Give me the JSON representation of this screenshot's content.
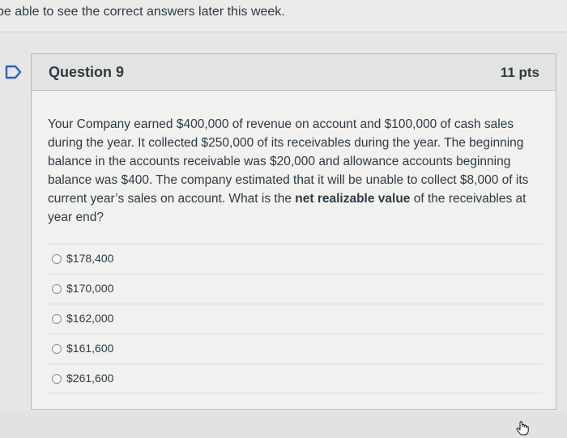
{
  "notice": {
    "text": "be able to see the correct answers later this week."
  },
  "question": {
    "flag_icon": "bookmark-flag-icon",
    "title": "Question 9",
    "points": "11 pts",
    "text_parts": [
      "Your Company earned $400,000 of revenue on account and $100,000 of cash sales during the year.  It collected $250,000 of its receivables during the year.  The beginning balance in the accounts receivable was $20,000 and allowance accounts beginning balance was $400.  The company estimated that it will be unable to collect $8,000 of its current year’s sales on account.  What is the ",
      "net realizable value",
      " of the receivables at year end?"
    ],
    "answers": [
      {
        "label": "$178,400"
      },
      {
        "label": "$170,000"
      },
      {
        "label": "$162,000"
      },
      {
        "label": "$161,600"
      },
      {
        "label": "$261,600"
      }
    ]
  },
  "colors": {
    "text": "#2d3b45",
    "card_background": "#f1f1ef",
    "header_background": "#e3e3e1",
    "flag_accent": "#2a62b5"
  }
}
